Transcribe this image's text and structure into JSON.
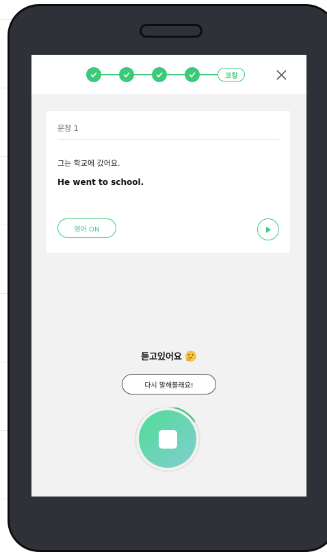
{
  "header": {
    "steps": [
      {
        "state": "done"
      },
      {
        "state": "done"
      },
      {
        "state": "done"
      },
      {
        "state": "done"
      }
    ],
    "coaching_label": "코칭",
    "close_icon": "close-icon"
  },
  "card": {
    "sentence_label": "문장 1",
    "korean": "그는 학교에 갔어요.",
    "english": "He went to school.",
    "english_toggle_label": "영어 ON",
    "play_icon": "play-icon"
  },
  "status": {
    "listening_text": "듣고있어요",
    "emoji": "🤔",
    "retry_label": "다시 말해볼래요!"
  },
  "recorder": {
    "icon": "stop-icon",
    "progress_fraction": 0.15
  },
  "colors": {
    "accent": "#3cc97a",
    "phone_body": "#2f3139",
    "screen_bg": "#f2f2f2"
  }
}
